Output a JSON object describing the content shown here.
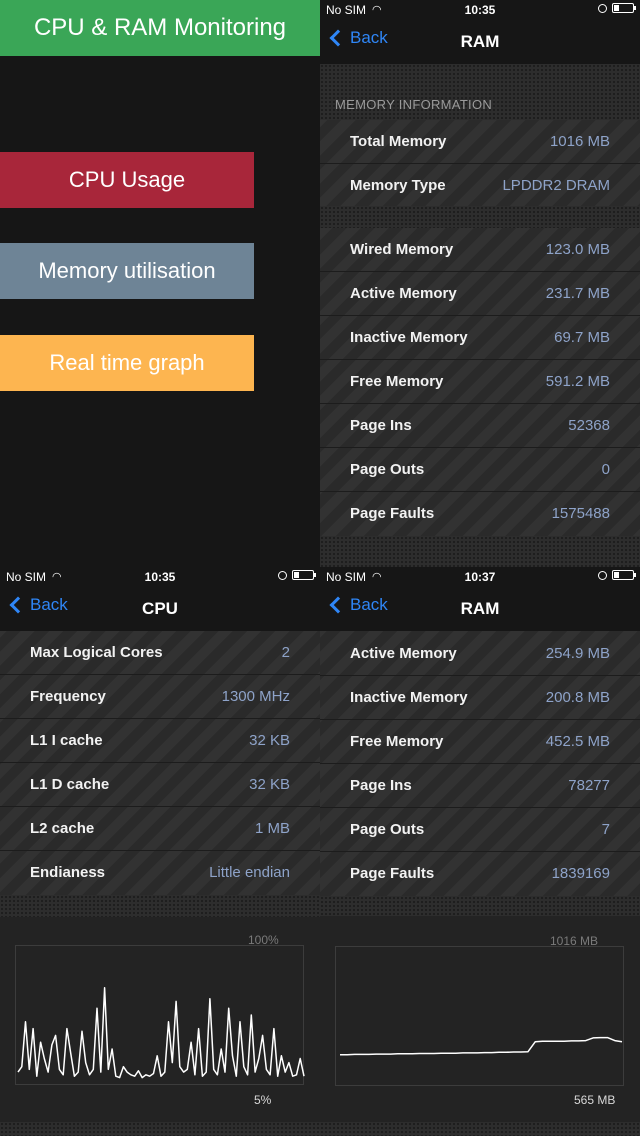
{
  "promo": {
    "title": "CPU & RAM Monitoring",
    "buttons": [
      {
        "label": "CPU Usage",
        "color": "#a8263a"
      },
      {
        "label": "Memory utilisation",
        "color": "#6e8496"
      },
      {
        "label": "Real time graph",
        "color": "#fdb550"
      }
    ],
    "title_color": "#3aa657"
  },
  "ram_screen_1": {
    "status": {
      "carrier": "No SIM",
      "time": "10:35"
    },
    "nav": {
      "back": "Back",
      "title": "RAM"
    },
    "section": "MEMORY INFORMATION",
    "group1": [
      {
        "label": "Total Memory",
        "value": "1016 MB"
      },
      {
        "label": "Memory Type",
        "value": "LPDDR2 DRAM"
      }
    ],
    "group2": [
      {
        "label": "Wired Memory",
        "value": "123.0 MB"
      },
      {
        "label": "Active Memory",
        "value": "231.7 MB"
      },
      {
        "label": "Inactive Memory",
        "value": "69.7 MB"
      },
      {
        "label": "Free Memory",
        "value": "591.2 MB"
      },
      {
        "label": "Page Ins",
        "value": "52368"
      },
      {
        "label": "Page Outs",
        "value": "0"
      },
      {
        "label": "Page Faults",
        "value": "1575488"
      }
    ]
  },
  "cpu_screen": {
    "status": {
      "carrier": "No SIM",
      "time": "10:35"
    },
    "nav": {
      "back": "Back",
      "title": "CPU"
    },
    "rows": [
      {
        "label": "Max Logical Cores",
        "value": "2"
      },
      {
        "label": "Frequency",
        "value": "1300 MHz"
      },
      {
        "label": "L1 I cache",
        "value": "32 KB"
      },
      {
        "label": "L1 D cache",
        "value": "32 KB"
      },
      {
        "label": "L2 cache",
        "value": "1 MB"
      },
      {
        "label": "Endianess",
        "value": "Little endian"
      }
    ],
    "graph": {
      "top_label": "100%",
      "bottom_label": "5%"
    }
  },
  "ram_screen_2": {
    "status": {
      "carrier": "No SIM",
      "time": "10:37"
    },
    "nav": {
      "back": "Back",
      "title": "RAM"
    },
    "rows": [
      {
        "label": "Active Memory",
        "value": "254.9 MB"
      },
      {
        "label": "Inactive Memory",
        "value": "200.8 MB"
      },
      {
        "label": "Free Memory",
        "value": "452.5 MB"
      },
      {
        "label": "Page Ins",
        "value": "78277"
      },
      {
        "label": "Page Outs",
        "value": "7"
      },
      {
        "label": "Page Faults",
        "value": "1839169"
      }
    ],
    "graph": {
      "top_label": "1016 MB",
      "bottom_label": "565 MB"
    }
  },
  "icons": [
    "chevron-left-icon",
    "wifi-icon",
    "orientation-lock-icon",
    "battery-icon"
  ],
  "colors": {
    "accent": "#2f86f6",
    "value_text": "#8ea3c9"
  },
  "chart_data": [
    {
      "type": "line",
      "name": "cpu",
      "ylim": [
        0,
        100
      ],
      "values": [
        8,
        12,
        45,
        10,
        40,
        5,
        30,
        18,
        8,
        28,
        35,
        10,
        6,
        40,
        22,
        5,
        8,
        38,
        15,
        6,
        10,
        55,
        8,
        70,
        10,
        25,
        5,
        4,
        12,
        8,
        6,
        5,
        9,
        4,
        6,
        5,
        7,
        20,
        5,
        8,
        45,
        15,
        60,
        12,
        8,
        10,
        30,
        6,
        40,
        5,
        8,
        62,
        10,
        6,
        25,
        8,
        55,
        20,
        5,
        45,
        12,
        6,
        50,
        8,
        18,
        35,
        10,
        6,
        40,
        5,
        20,
        8,
        15,
        5,
        6,
        18,
        5
      ]
    },
    {
      "type": "line",
      "name": "ram",
      "ylim": [
        565,
        1016
      ],
      "values": [
        662,
        662,
        663,
        663,
        663,
        664,
        664,
        664,
        665,
        665,
        665,
        666,
        666,
        666,
        667,
        667,
        667,
        668,
        668,
        668,
        669,
        669,
        670,
        670,
        671,
        671,
        672,
        705,
        707,
        707,
        707,
        707,
        708,
        708,
        709,
        718,
        719,
        719,
        709,
        705
      ]
    }
  ]
}
